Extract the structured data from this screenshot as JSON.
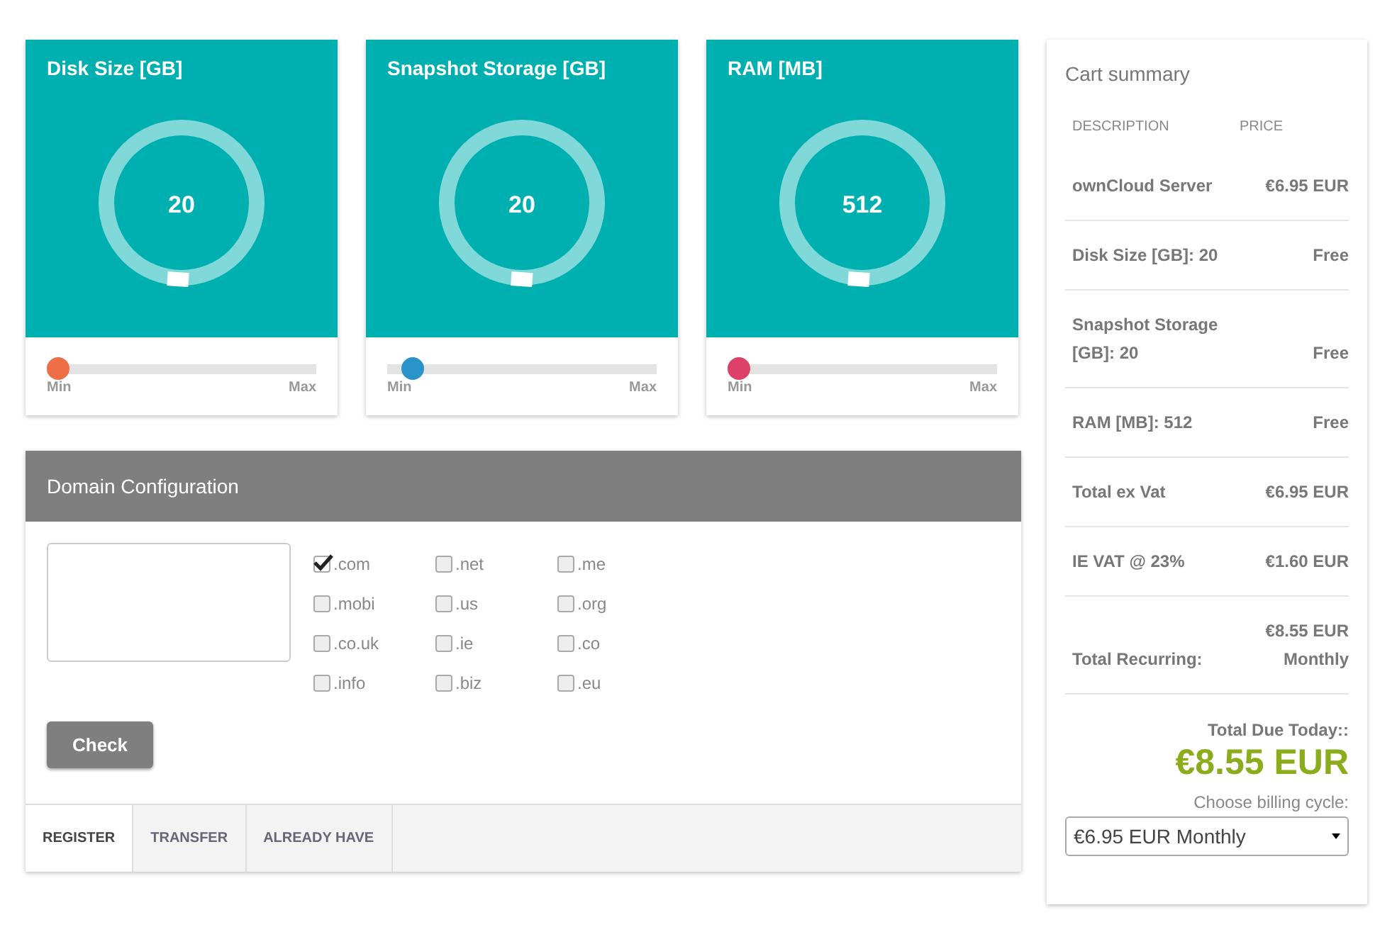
{
  "resources": [
    {
      "title": "Disk Size [GB]",
      "value": "20",
      "level": 0,
      "color": "#ee6e47",
      "min": "Min",
      "max": "Max"
    },
    {
      "title": "Snapshot Storage [GB]",
      "value": "20",
      "level": 0.06,
      "color": "#2a93c9",
      "min": "Min",
      "max": "Max"
    },
    {
      "title": "RAM [MB]",
      "value": "512",
      "level": 0,
      "color": "#dd4169",
      "min": "Min",
      "max": "Max"
    }
  ],
  "domain": {
    "title": "Domain Configuration",
    "button": "Check",
    "tlds": [
      {
        "label": ".com",
        "checked": true
      },
      {
        "label": ".net",
        "checked": false
      },
      {
        "label": ".me",
        "checked": false
      },
      {
        "label": ".mobi",
        "checked": false
      },
      {
        "label": ".us",
        "checked": false
      },
      {
        "label": ".org",
        "checked": false
      },
      {
        "label": ".co.uk",
        "checked": false
      },
      {
        "label": ".ie",
        "checked": false
      },
      {
        "label": ".co",
        "checked": false
      },
      {
        "label": ".info",
        "checked": false
      },
      {
        "label": ".biz",
        "checked": false
      },
      {
        "label": ".eu",
        "checked": false
      }
    ],
    "tabs": [
      {
        "label": "REGISTER",
        "selected": true
      },
      {
        "label": "TRANSFER",
        "selected": false
      },
      {
        "label": "ALREADY HAVE",
        "selected": false
      }
    ]
  },
  "cart": {
    "title": "Cart summary",
    "columns": [
      "DESCRIPTION",
      "PRICE"
    ],
    "rows": [
      {
        "description": "ownCloud Server",
        "price": "€6.95 EUR"
      },
      {
        "description": "Disk Size [GB]: 20",
        "price": "Free"
      },
      {
        "description": "Snapshot Storage [GB]: 20",
        "price": "Free"
      },
      {
        "description": "RAM [MB]: 512",
        "price": "Free"
      },
      {
        "description": "Total ex Vat",
        "price": "€6.95 EUR"
      },
      {
        "description": "IE VAT @ 23%",
        "price": "€1.60 EUR"
      },
      {
        "description": "Total Recurring:",
        "price": "€8.55 EUR Monthly"
      }
    ],
    "due_label": "Total Due Today::",
    "due_amount": "€8.55 EUR",
    "cycle_label": "Choose billing cycle:",
    "cycle_value": "€6.95 EUR Monthly"
  }
}
